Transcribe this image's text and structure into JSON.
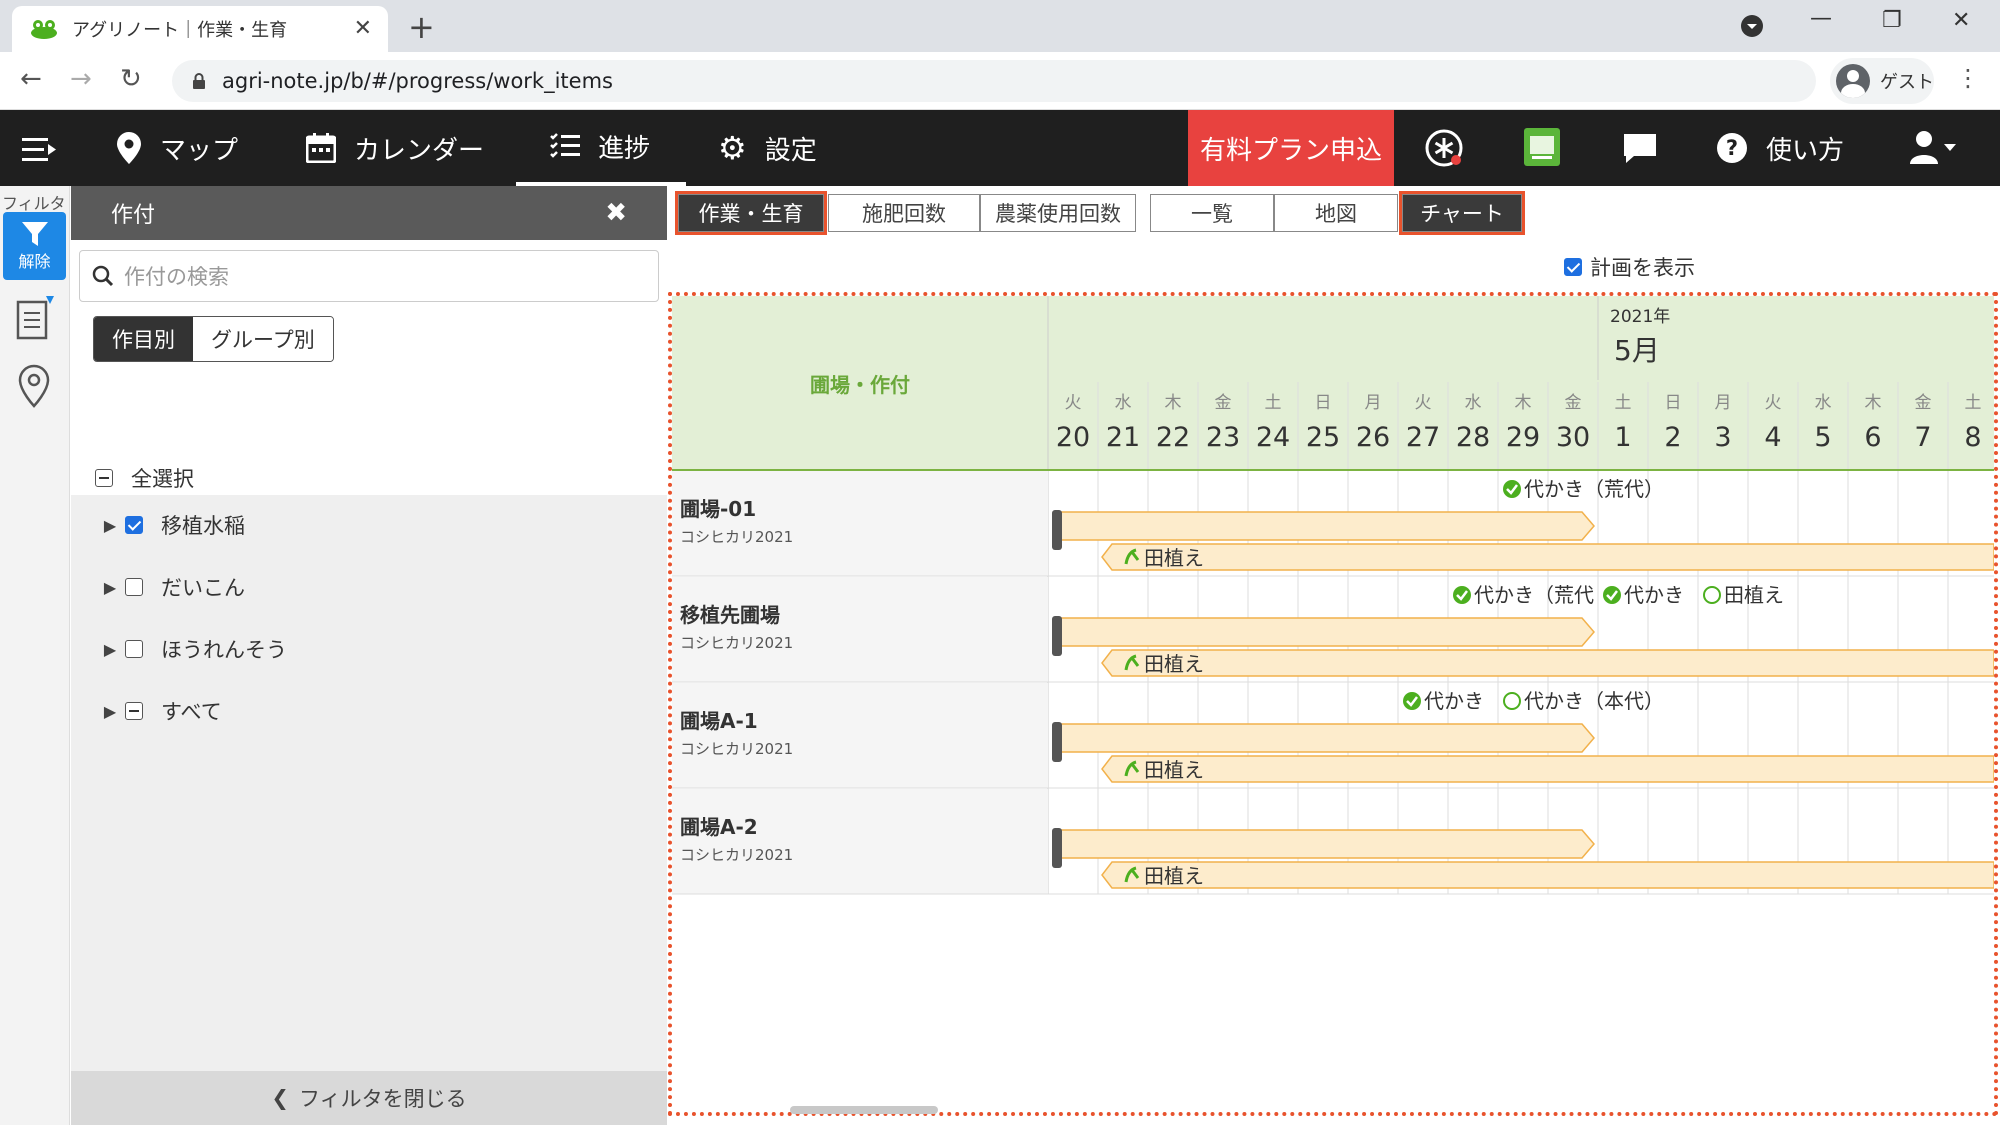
{
  "browser": {
    "tab_title": "アグリノート｜作業・生育",
    "url": "agri-note.jp/b/#/progress/work_items",
    "profile": "ゲスト"
  },
  "nav": {
    "map": "マップ",
    "calendar": "カレンダー",
    "progress": "進捗",
    "settings": "設定",
    "plan": "有料プラン申込",
    "help": "使い方"
  },
  "filter": {
    "strip_label": "フィルタ",
    "release": "解除"
  },
  "sidebar": {
    "title": "作付",
    "search_placeholder": "作付の検索",
    "seg_on": "作目別",
    "seg_off": "グループ別",
    "select_all": "全選択",
    "items": [
      {
        "label": "移植水稲",
        "state": "checked"
      },
      {
        "label": "だいこん",
        "state": "unchecked"
      },
      {
        "label": "ほうれんそう",
        "state": "unchecked"
      },
      {
        "label": "すべて",
        "state": "indeterminate"
      }
    ],
    "close": "フィルタを閉じる"
  },
  "tabs": {
    "group1": [
      "作業・生育",
      "施肥回数",
      "農薬使用回数"
    ],
    "group2": [
      "一覧",
      "地図",
      "チャート"
    ],
    "active1": "作業・生育",
    "active2": "チャート"
  },
  "show_plan": "計画を表示",
  "chart": {
    "header_label": "圃場・作付",
    "year": "2021年",
    "month": "5月",
    "days": [
      {
        "w": "火",
        "d": "20"
      },
      {
        "w": "水",
        "d": "21"
      },
      {
        "w": "木",
        "d": "22"
      },
      {
        "w": "金",
        "d": "23"
      },
      {
        "w": "土",
        "d": "24"
      },
      {
        "w": "日",
        "d": "25"
      },
      {
        "w": "月",
        "d": "26"
      },
      {
        "w": "火",
        "d": "27"
      },
      {
        "w": "水",
        "d": "28"
      },
      {
        "w": "木",
        "d": "29"
      },
      {
        "w": "金",
        "d": "30"
      },
      {
        "w": "土",
        "d": "1"
      },
      {
        "w": "日",
        "d": "2"
      },
      {
        "w": "月",
        "d": "3"
      },
      {
        "w": "火",
        "d": "4"
      },
      {
        "w": "水",
        "d": "5"
      },
      {
        "w": "木",
        "d": "6"
      },
      {
        "w": "金",
        "d": "7"
      },
      {
        "w": "土",
        "d": "8"
      }
    ],
    "rows": [
      {
        "field": "圃場-01",
        "crop": "コシヒカリ2021",
        "bar_label": "田植え",
        "events": [
          {
            "day": 9,
            "done": true,
            "label": "代かき（荒代）"
          }
        ]
      },
      {
        "field": "移植先圃場",
        "crop": "コシヒカリ2021",
        "bar_label": "田植え",
        "events": [
          {
            "day": 8,
            "done": true,
            "label": "代かき（荒代"
          },
          {
            "day": 11,
            "done": true,
            "label": "代かき"
          },
          {
            "day": 13,
            "done": false,
            "label": "田植え"
          }
        ]
      },
      {
        "field": "圃場A-1",
        "crop": "コシヒカリ2021",
        "bar_label": "田植え",
        "events": [
          {
            "day": 7,
            "done": true,
            "label": "代かき"
          },
          {
            "day": 9,
            "done": false,
            "label": "代かき（本代）"
          }
        ]
      },
      {
        "field": "圃場A-2",
        "crop": "コシヒカリ2021",
        "bar_label": "田植え",
        "events": []
      }
    ]
  },
  "colors": {
    "accent": "#e8532d",
    "header_bg": "#e3efd6",
    "bar_fill": "#fdeccc",
    "bar_stroke": "#f2b14b",
    "done_green": "#4caf1f",
    "label_green": "#6aa83a"
  }
}
